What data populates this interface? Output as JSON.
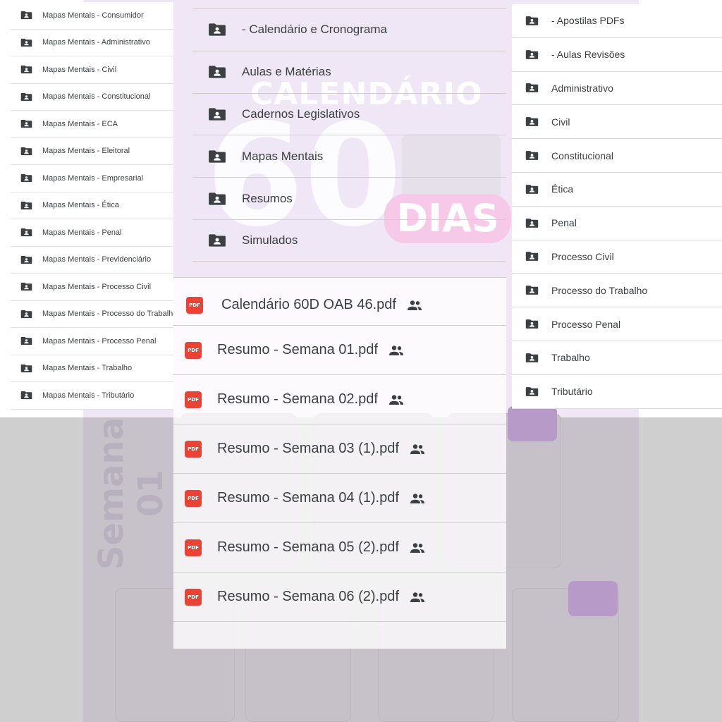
{
  "left_list": {
    "items": [
      "Mapas Mentais -  Consumidor",
      "Mapas Mentais - Administrativo",
      "Mapas Mentais - Civil",
      "Mapas Mentais - Constitucional",
      "Mapas Mentais - ECA",
      "Mapas Mentais - Eleitoral",
      "Mapas Mentais - Empresarial",
      "Mapas Mentais - Ética",
      "Mapas Mentais - Penal",
      "Mapas Mentais - Previdenciário",
      "Mapas Mentais - Processo Civil",
      "Mapas Mentais - Processo do Trabalho",
      "Mapas Mentais - Processo Penal",
      "Mapas Mentais - Trabalho",
      "Mapas Mentais - Tributário"
    ]
  },
  "middle_folders": {
    "items": [
      "- Calendário e Cronograma",
      "Aulas e Matérias",
      "Cadernos Legislativos",
      "Mapas Mentais",
      "Resumos",
      "Simulados"
    ]
  },
  "right_list": {
    "items": [
      "- Apostilas PDFs",
      "- Aulas Revisões",
      "Administrativo",
      "Civil",
      "Constitucional",
      "Ética",
      "Penal",
      "Processo Civil",
      "Processo do Trabalho",
      "Processo Penal",
      "Trabalho",
      "Tributário"
    ]
  },
  "pdf_files": {
    "icon_label": "PDF",
    "items": [
      "Calendário 60D OAB 46.pdf",
      "Resumo - Semana 01.pdf",
      "Resumo - Semana 02.pdf",
      "Resumo - Semana 03 (1).pdf",
      "Resumo - Semana 04 (1).pdf",
      "Resumo - Semana 05 (2).pdf",
      "Resumo - Semana 06 (2).pdf"
    ]
  },
  "background_poster": {
    "title": "CALENDÁRIO",
    "big_number": "60",
    "dias": "DIAS",
    "semana": "Semana 01"
  },
  "colors": {
    "folder_icon": "#3c4043",
    "pdf_icon": "#ea4335",
    "poster_bg": "#efe6f6",
    "lower_bg": "#cfcfcf"
  },
  "icons": {
    "folder": "shared-folder-icon",
    "pdf": "pdf-file-icon",
    "shared": "people-icon"
  }
}
